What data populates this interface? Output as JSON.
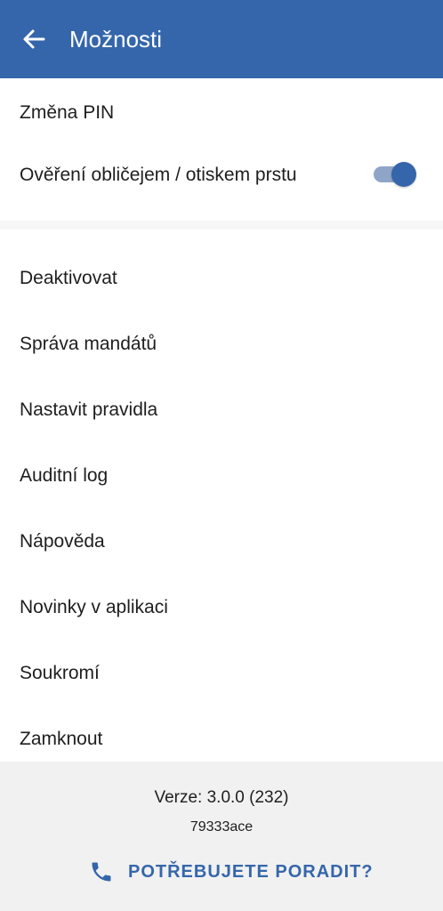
{
  "appbar": {
    "title": "Možnosti",
    "back_icon": "arrow-left-icon",
    "color": "#3566ab"
  },
  "security": {
    "change_pin": "Změna PIN",
    "biometric_label": "Ověření obličejem / otiskem prstu",
    "biometric_enabled": true
  },
  "menu": {
    "items": [
      {
        "label": "Deaktivovat"
      },
      {
        "label": "Správa mandátů"
      },
      {
        "label": "Nastavit pravidla"
      },
      {
        "label": "Auditní log"
      },
      {
        "label": "Nápověda"
      },
      {
        "label": "Novinky v aplikaci"
      },
      {
        "label": "Soukromí"
      },
      {
        "label": "Zamknout"
      }
    ]
  },
  "footer": {
    "version": "Verze: 3.0.0 (232)",
    "build": "79333ace",
    "help_label": "POTŘEBUJETE PORADIT?",
    "help_icon": "phone-icon"
  }
}
